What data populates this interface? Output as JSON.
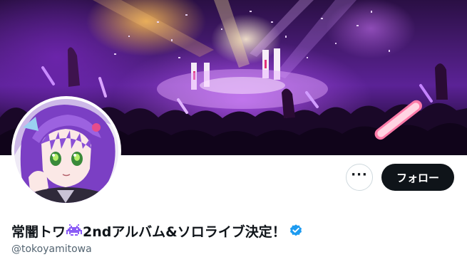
{
  "profile": {
    "name_part1": "常闇トワ",
    "name_emoji": "space-invader-purple-icon",
    "name_part2": "2ndアルバム&ソロライブ決定！",
    "handle": "@tokoyamitowa",
    "verified": true
  },
  "actions": {
    "more_label": "···",
    "follow_label": "フォロー"
  },
  "banner": {
    "description_icon": "concert-crowd-banner"
  },
  "colors": {
    "follow_bg": "#0f1419",
    "verified_blue": "#1d9bf0",
    "handle_gray": "#536471",
    "emoji_purple": "#8b5cf6"
  }
}
